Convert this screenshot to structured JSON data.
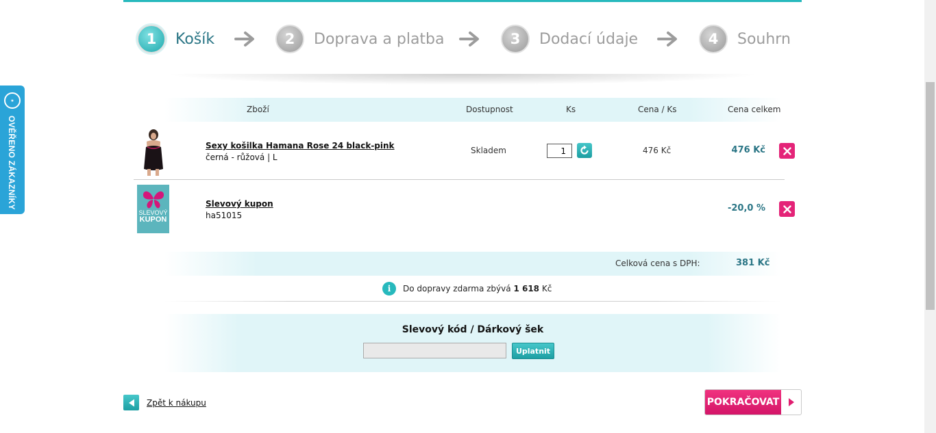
{
  "steps": [
    {
      "number": "1",
      "label": "Košík",
      "active": true
    },
    {
      "number": "2",
      "label": "Doprava a platba",
      "active": false
    },
    {
      "number": "3",
      "label": "Dodací údaje",
      "active": false
    },
    {
      "number": "4",
      "label": "Souhrn",
      "active": false
    }
  ],
  "table": {
    "headers": {
      "product": "Zboží",
      "availability": "Dostupnost",
      "quantity": "Ks",
      "unit_price": "Cena / Ks",
      "total_price": "Cena celkem"
    },
    "items": [
      {
        "name": "Sexy košilka Hamana Rose 24 black-pink",
        "variant": "černá - růžová | L",
        "availability": "Skladem",
        "quantity": "1",
        "unit_price": "476 Kč",
        "total_price": "476 Kč"
      },
      {
        "name": "Slevový kupon",
        "variant": "ha51015",
        "thumb_line1": "SLEVOVÝ",
        "thumb_line2": "KUPON",
        "total_price": "-20,0 %"
      }
    ]
  },
  "summary": {
    "total_label": "Celková cena s DPH:",
    "total_value": "381 Kč"
  },
  "shipping": {
    "text_before": "Do dopravy zdarma zbývá",
    "amount": "1 618",
    "currency": "Kč"
  },
  "coupon": {
    "title": "Slevový kód / Dárkový šek",
    "input_value": "",
    "apply_label": "Uplatnit"
  },
  "navigation": {
    "back_label": "Zpět k nákupu",
    "continue_label": "POKRAČOVAT"
  },
  "side_badge": {
    "label": "OVĚŘENO ZÁKAZNÍKY"
  },
  "colors": {
    "accent": "#27b9bd",
    "price": "#2a7585",
    "delete": "#e42478",
    "continue": "#e01e70",
    "badge": "#2aa4d8"
  }
}
